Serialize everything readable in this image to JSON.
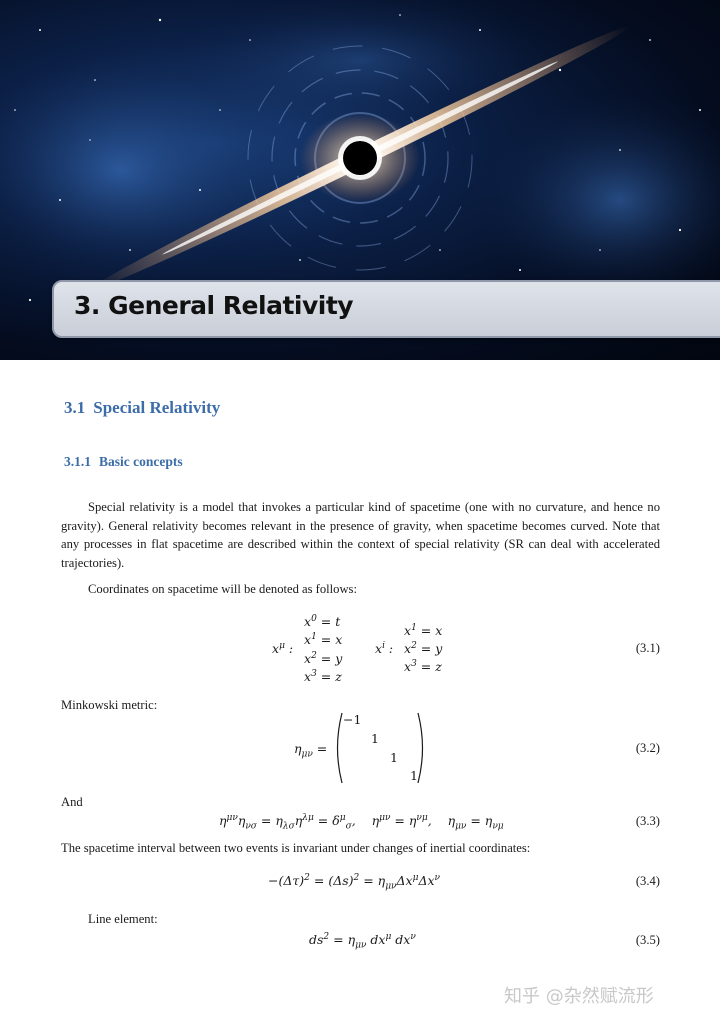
{
  "chapter": {
    "title": "3. General Relativity"
  },
  "section": {
    "number": "3.1",
    "title": "Special Relativity"
  },
  "subsection": {
    "number": "3.1.1",
    "title": "Basic concepts"
  },
  "paragraphs": {
    "intro": "Special relativity is a model that invokes a particular kind of spacetime (one with no curvature, and hence no gravity).  General relativity becomes relevant in the presence of gravity, when spacetime becomes curved. Note that any processes in flat spacetime are described within the context of special relativity (SR can deal with accelerated trajectories).",
    "coords": "Coordinates on spacetime will be denoted as follows:",
    "minkowski": "Minkowski metric:",
    "and": "And",
    "interval": "The spacetime interval between two events is invariant under changes of inertial coordinates:",
    "line_element": "Line element:"
  },
  "equation_numbers": [
    "(3.1)",
    "(3.2)",
    "(3.3)",
    "(3.4)",
    "(3.5)"
  ],
  "watermark": "知乎 @杂然赋流形"
}
